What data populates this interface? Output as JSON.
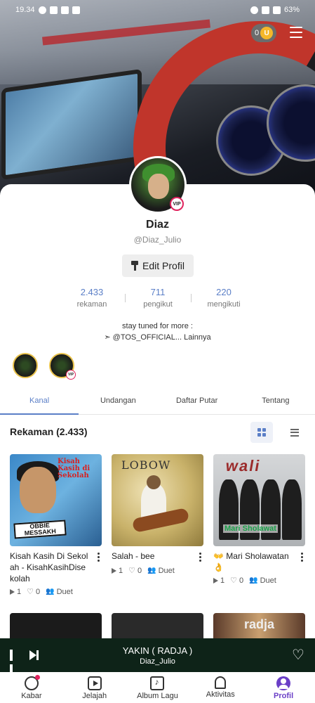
{
  "status_bar": {
    "time": "19.34",
    "battery": "63%"
  },
  "header": {
    "coin_count": "0"
  },
  "profile": {
    "name": "Diaz",
    "handle": "@Diaz_Julio",
    "edit_label": "Edit Profil",
    "vip_label": "VIP",
    "stats": [
      {
        "value": "2.433",
        "label": "rekaman"
      },
      {
        "value": "711",
        "label": "pengikut"
      },
      {
        "value": "220",
        "label": "mengikuti"
      }
    ],
    "bio_line1": "stay tuned for more :",
    "bio_line2": "➣ @TOS_OFFICIAL... Lainnya"
  },
  "tabs": [
    "Kanal",
    "Undangan",
    "Daftar Putar",
    "Tentang"
  ],
  "section": {
    "title": "Rekaman (2.433)"
  },
  "recordings": [
    {
      "title": "Kisah Kasih Di Sekolah - KisahKasihDisekolah",
      "plays": "1",
      "likes": "0",
      "duet": "Duet",
      "cover_text": "Kisah Kasih di Sekolah",
      "cover_logo": "OBBIE MESSAKH"
    },
    {
      "title": "Salah - bee",
      "plays": "1",
      "likes": "0",
      "duet": "Duet",
      "cover_text": "LOBOW"
    },
    {
      "title": "👐 Mari Sholawatan 👌",
      "plays": "1",
      "likes": "0",
      "duet": "Duet",
      "cover_text": "wali",
      "cover_sub": "Mari Sholawat"
    }
  ],
  "row2_cover_text": "radja",
  "player": {
    "title": "YAKIN ( RADJA )",
    "artist": "Diaz_Julio"
  },
  "nav": [
    {
      "label": "Kabar",
      "icon": "news-icon"
    },
    {
      "label": "Jelajah",
      "icon": "play-icon"
    },
    {
      "label": "Album Lagu",
      "icon": "album-icon"
    },
    {
      "label": "Aktivitas",
      "icon": "bell-icon"
    },
    {
      "label": "Profil",
      "icon": "profile-icon"
    }
  ],
  "colors": {
    "accent": "#5b7fc7",
    "nav_active": "#6a3fc7",
    "player_bg": "#0e2318"
  }
}
